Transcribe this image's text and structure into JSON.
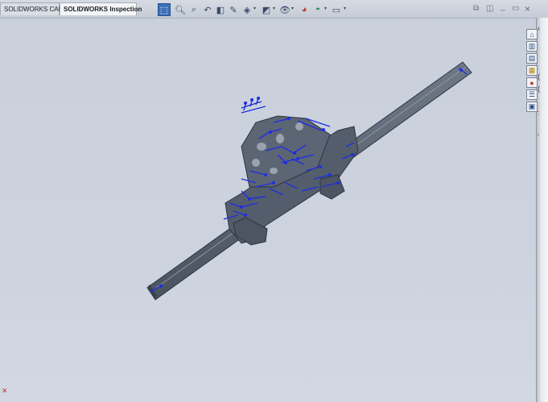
{
  "tabs": [
    {
      "label": "SOLIDWORKS CAM",
      "active": false
    },
    {
      "label": "SOLIDWORKS Inspection",
      "active": true
    }
  ],
  "hud_toolbar": {
    "buttons": [
      {
        "icon": "select-icon",
        "glyph": "⬚",
        "active": true
      },
      {
        "icon": "zoom-to-fit-icon",
        "glyph": "🔍︎",
        "active": false
      },
      {
        "icon": "zoom-to-area-icon",
        "glyph": "⌕",
        "active": false
      },
      {
        "icon": "previous-view-icon",
        "glyph": "↶",
        "active": false
      },
      {
        "icon": "section-view-icon",
        "glyph": "◧",
        "active": false
      },
      {
        "icon": "dynamic-annotation-icon",
        "glyph": "✎",
        "active": false
      },
      {
        "icon": "view-orientation-icon",
        "glyph": "◈",
        "active": false
      },
      {
        "icon": "display-style-icon",
        "glyph": "◩",
        "active": false
      },
      {
        "icon": "hide-show-items-icon",
        "glyph": "👁︎",
        "active": false
      },
      {
        "icon": "edit-appearance-icon",
        "glyph": "◕",
        "active": false
      },
      {
        "icon": "apply-scene-icon",
        "glyph": "◓",
        "active": false
      },
      {
        "icon": "view-settings-icon",
        "glyph": "▭",
        "active": false
      }
    ]
  },
  "window_controls": [
    "restore-icon",
    "tile-icon",
    "minimize-icon",
    "maximize-icon",
    "close-icon"
  ],
  "window_control_glyphs": [
    "⧉",
    "◫",
    "_",
    "▭",
    "×"
  ],
  "task_pane": {
    "icons": [
      {
        "name": "home-icon",
        "glyph": "⌂"
      },
      {
        "name": "resources-icon",
        "glyph": "▥"
      },
      {
        "name": "design-library-icon",
        "glyph": "▤"
      },
      {
        "name": "file-explorer-icon",
        "glyph": "▦"
      },
      {
        "name": "appearances-icon",
        "glyph": "●"
      },
      {
        "name": "custom-properties-icon",
        "glyph": "☰"
      },
      {
        "name": "forum-icon",
        "glyph": "▣"
      }
    ],
    "edge_marks": [
      "‹",
      " ",
      " ",
      " ",
      "(",
      "(",
      " ",
      ":",
      " ",
      "'"
    ]
  },
  "colors": {
    "viewport_bg": "#cdd3de",
    "model_body": "#5a6372",
    "model_edge": "#2e3440",
    "annotation": "#1f2fe0",
    "active_button": "#3c70b8"
  }
}
